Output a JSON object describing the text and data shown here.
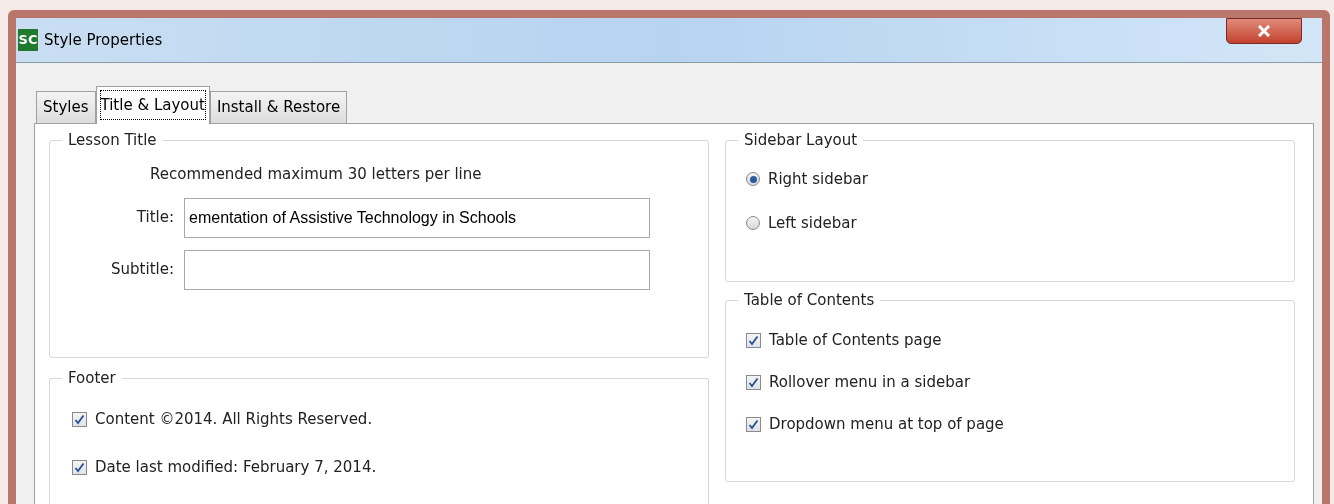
{
  "window": {
    "title": "Style Properties",
    "icon_text": "SC"
  },
  "tabs": [
    {
      "label": "Styles",
      "selected": false
    },
    {
      "label": "Title & Layout",
      "selected": true
    },
    {
      "label": "Install & Restore",
      "selected": false
    }
  ],
  "lesson_title": {
    "title": "Lesson Title",
    "note": "Recommended maximum 30 letters per line",
    "fields": [
      {
        "label": "Title:",
        "value": "ementation of Assistive Technology in Schools"
      },
      {
        "label": "Subtitle:"
      }
    ]
  },
  "footer": {
    "title": "Footer",
    "items": [
      {
        "label": "Content ©2014. All Rights Reserved.",
        "checked": true
      },
      {
        "label": "Date last modified: February 7, 2014.",
        "checked": true
      }
    ]
  },
  "sidebar_layout": {
    "title": "Sidebar Layout",
    "options": [
      {
        "label": "Right sidebar",
        "selected": true
      },
      {
        "label": "Left sidebar",
        "selected": false
      }
    ]
  },
  "table_of_contents": {
    "title": "Table of Contents",
    "items": [
      {
        "label": "Table of Contents page",
        "checked": true
      },
      {
        "label": "Rollover menu in a sidebar",
        "checked": true
      },
      {
        "label": "Dropdown menu at top of page",
        "checked": true
      }
    ]
  }
}
